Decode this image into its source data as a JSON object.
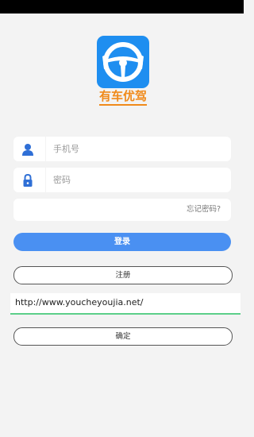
{
  "app": {
    "logo_text": "有车优驾",
    "brand_color": "#1e8ef0",
    "logo_text_color": "#f08a1a"
  },
  "login_form": {
    "phone_placeholder": "手机号",
    "phone_icon": "user-icon",
    "password_placeholder": "密码",
    "password_icon": "lock-icon",
    "forgot_password_label": "忘记密码?",
    "login_button_label": "登录",
    "login_button_color": "#4a90f2"
  },
  "register": {
    "button_label": "注册"
  },
  "server_config": {
    "url_value": "http://www.youcheyoujia.net/",
    "confirm_button_label": "确定",
    "focus_color": "#5ccf8a"
  }
}
